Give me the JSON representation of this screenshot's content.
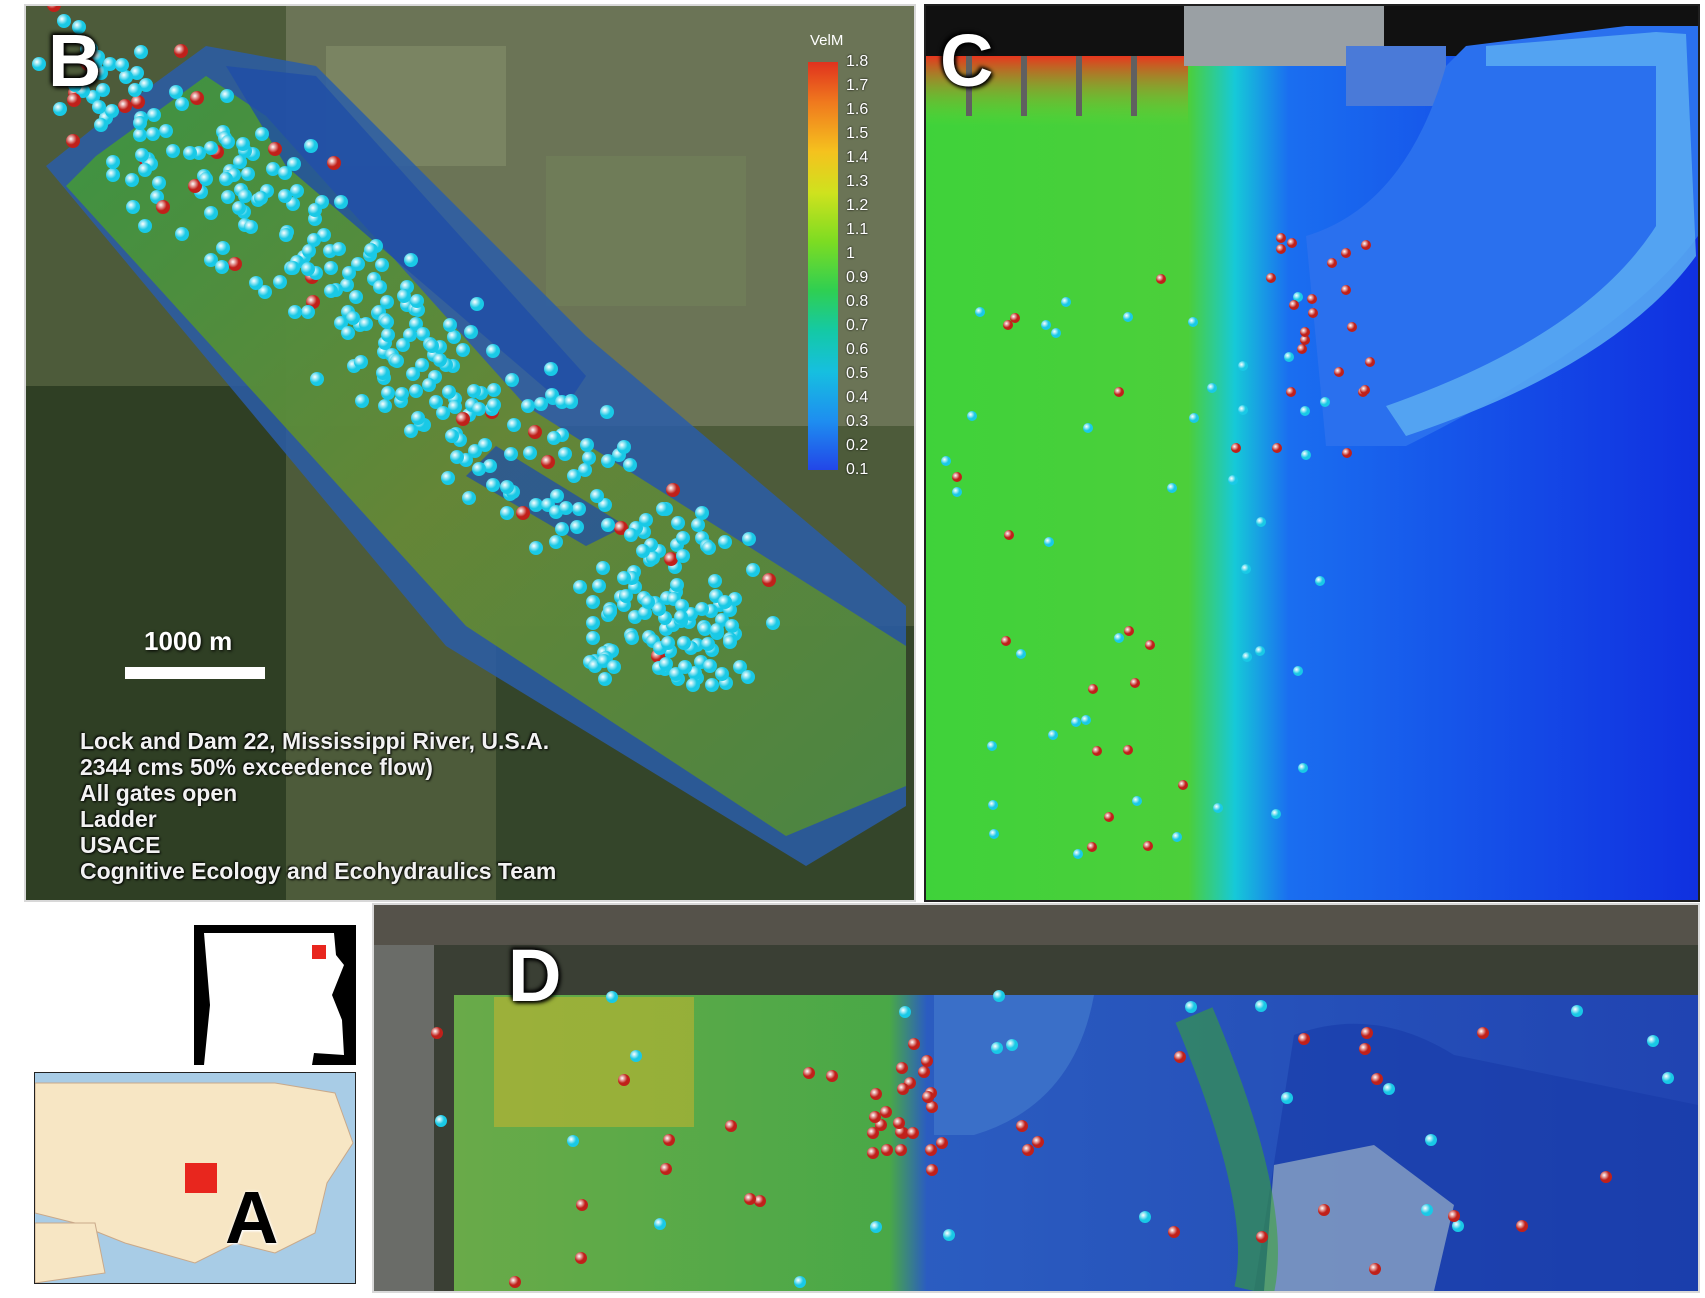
{
  "panels": {
    "b": {
      "letter": "B"
    },
    "c": {
      "letter": "C"
    },
    "d": {
      "letter": "D"
    },
    "a": {
      "letter": "A"
    }
  },
  "legend": {
    "title": "VelM",
    "ticks": [
      "1.8",
      "1.7",
      "1.6",
      "1.5",
      "1.4",
      "1.3",
      "1.2",
      "1.1",
      "1",
      "0.9",
      "0.8",
      "0.7",
      "0.6",
      "0.5",
      "0.4",
      "0.3",
      "0.2",
      "0.1"
    ]
  },
  "scale_bar": {
    "label": "1000 m"
  },
  "caption": {
    "lines": [
      "Lock and Dam 22, Mississippi River, U.S.A.",
      "2344 cms 50% exceedence flow)",
      "All gates open",
      "Ladder",
      "USACE",
      "Cognitive Ecology and Ecohydraulics Team"
    ]
  },
  "colors": {
    "fish_marker_cyan": "#19c9e6",
    "fish_marker_red": "#c0201a",
    "velocity_high": "#e0321e",
    "velocity_low": "#2246e8",
    "missouri_highlight": "#e8261e",
    "usa_land": "#f7e6c4",
    "ocean": "#a8cce6"
  }
}
